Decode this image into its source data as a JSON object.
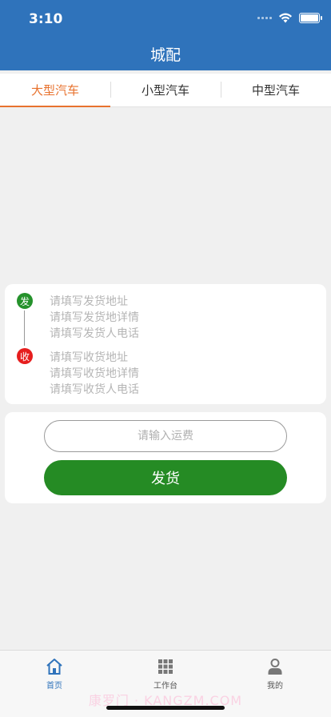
{
  "status_bar": {
    "time": "3:10"
  },
  "header": {
    "title": "城配"
  },
  "tabs": [
    {
      "label": "大型汽车",
      "active": true
    },
    {
      "label": "小型汽车",
      "active": false
    },
    {
      "label": "中型汽车",
      "active": false
    }
  ],
  "address": {
    "send_marker": "发",
    "recv_marker": "收",
    "sender": {
      "address_placeholder": "请填写发货地址",
      "detail_placeholder": "请填写发货地详情",
      "phone_placeholder": "请填写发货人电话"
    },
    "receiver": {
      "address_placeholder": "请填写收货地址",
      "detail_placeholder": "请填写收货地详情",
      "phone_placeholder": "请填写收货人电话"
    },
    "colors": {
      "send": "#25922b",
      "receive": "#e61e1e"
    }
  },
  "fee": {
    "placeholder": "请输入运费",
    "value": ""
  },
  "submit": {
    "label": "发货",
    "color": "#258b24"
  },
  "tabbar": {
    "items": [
      {
        "label": "首页",
        "icon": "home-icon",
        "active": true
      },
      {
        "label": "工作台",
        "icon": "grid-icon",
        "active": false
      },
      {
        "label": "我的",
        "icon": "user-icon",
        "active": false
      }
    ]
  },
  "watermark": "康罗门 · KANGZM.COM",
  "theme": {
    "primary": "#2f73bb",
    "accent": "#e8722e"
  }
}
